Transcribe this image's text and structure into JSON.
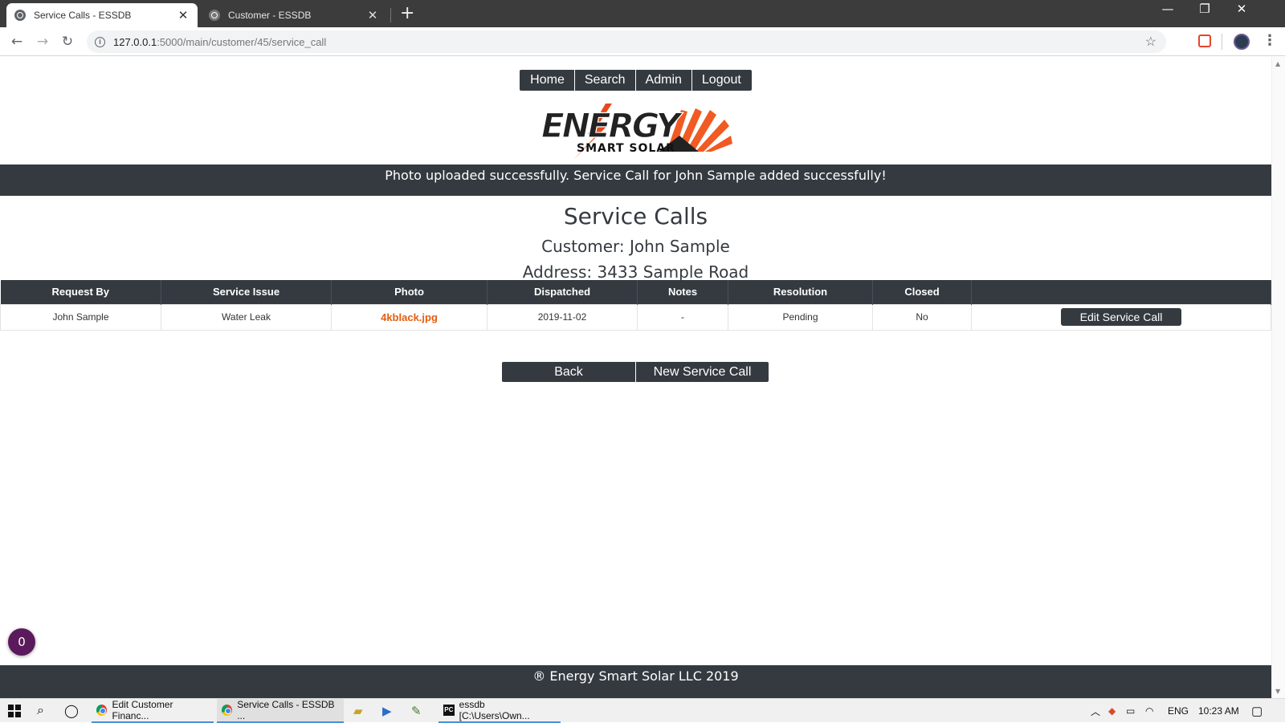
{
  "browser": {
    "tabs": [
      {
        "title": "Service Calls - ESSDB",
        "active": true
      },
      {
        "title": "Customer - ESSDB",
        "active": false
      }
    ],
    "url_host": "127.0.0.1",
    "url_path": ":5000/main/customer/45/service_call"
  },
  "nav": {
    "home": "Home",
    "search": "Search",
    "admin": "Admin",
    "logout": "Logout"
  },
  "logo": {
    "word1": "ENERGY",
    "word2": "SMART SOLAR"
  },
  "flash_message": "Photo uploaded successfully. Service Call for John Sample added successfully!",
  "page": {
    "title": "Service Calls",
    "customer_line": "Customer: John Sample",
    "address_line": "Address: 3433 Sample Road"
  },
  "table": {
    "headers": [
      "Request By",
      "Service Issue",
      "Photo",
      "Dispatched",
      "Notes",
      "Resolution",
      "Closed",
      ""
    ],
    "rows": [
      {
        "request_by": "John Sample",
        "service_issue": "Water Leak",
        "photo": "4kblack.jpg",
        "dispatched": "2019-11-02",
        "notes": "-",
        "resolution": "Pending",
        "closed": "No",
        "action": "Edit Service Call"
      }
    ]
  },
  "buttons": {
    "back": "Back",
    "new_service_call": "New Service Call"
  },
  "badge_count": "0",
  "footer": "® Energy Smart Solar LLC 2019",
  "taskbar": {
    "apps": [
      {
        "label": "Edit Customer Financ..."
      },
      {
        "label": "Service Calls - ESSDB ..."
      },
      {
        "label": "essdb [C:\\Users\\Own..."
      }
    ],
    "lang": "ENG",
    "time": "10:23 AM"
  },
  "colors": {
    "dark": "#343a40",
    "accent": "#e35d0f",
    "badge": "#5b1a5c"
  }
}
